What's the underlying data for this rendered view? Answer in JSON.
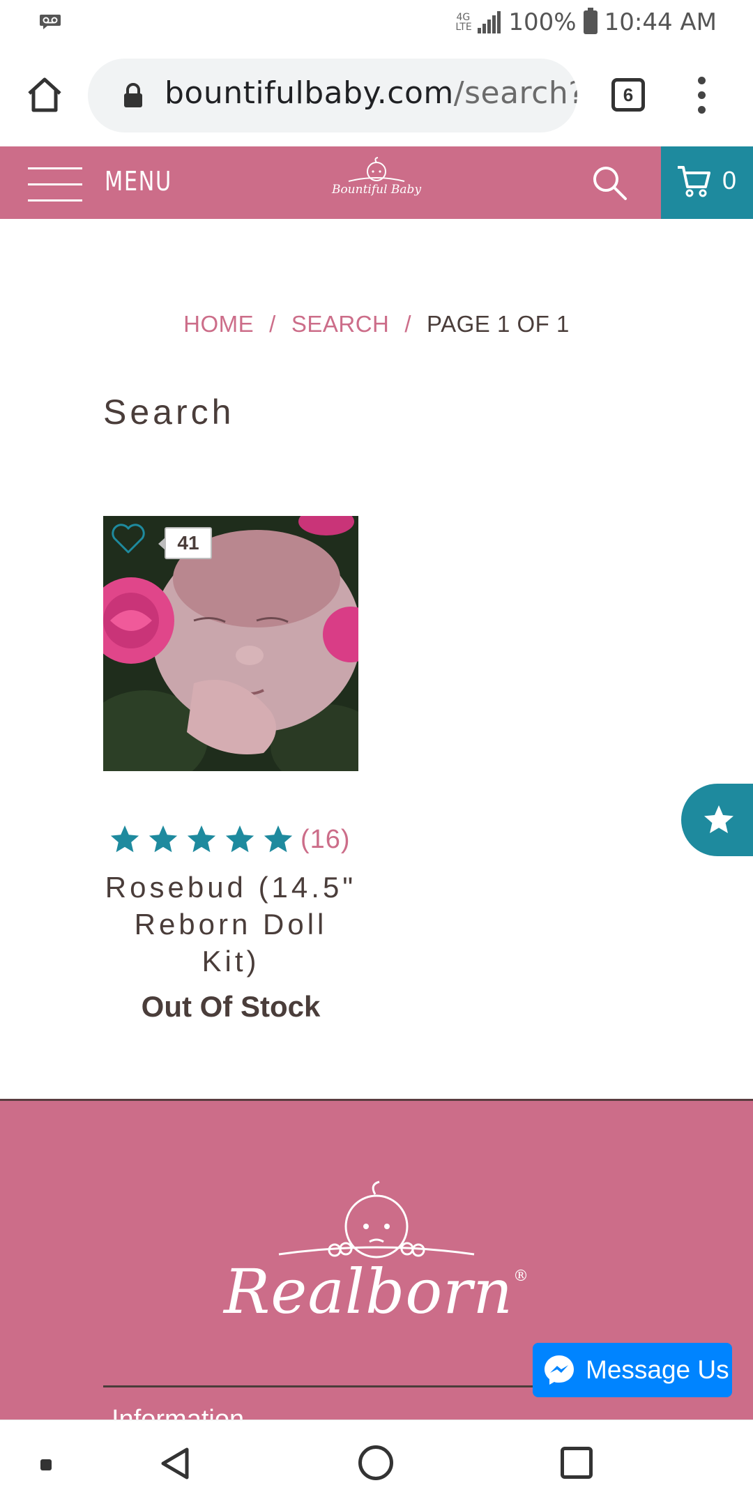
{
  "status_bar": {
    "network": "4G LTE",
    "battery": "100%",
    "time": "10:44 AM"
  },
  "browser": {
    "url_domain": "bountifulbaby.com",
    "url_path": "/search?t",
    "tab_count": "6"
  },
  "header": {
    "menu_label": "MENU",
    "logo_text": "Bountiful Baby",
    "cart_count": "0"
  },
  "breadcrumb": {
    "home": "HOME",
    "separator": "/",
    "search": "SEARCH",
    "current": "PAGE 1 OF 1"
  },
  "page_title": "Search",
  "product": {
    "wishlist_count": "41",
    "rating_stars": 5,
    "review_count": "(16)",
    "name": "Rosebud (14.5\" Reborn Doll Kit)",
    "stock_status": "Out Of Stock"
  },
  "footer": {
    "logo_text": "Realborn",
    "registered_mark": "®",
    "peek_text": "Information"
  },
  "message_button": {
    "label": "Message Us"
  },
  "colors": {
    "brand_pink": "#cc6d89",
    "brand_teal": "#1e8a9e",
    "messenger_blue": "#0084ff",
    "text_dark": "#4a3d3a"
  }
}
